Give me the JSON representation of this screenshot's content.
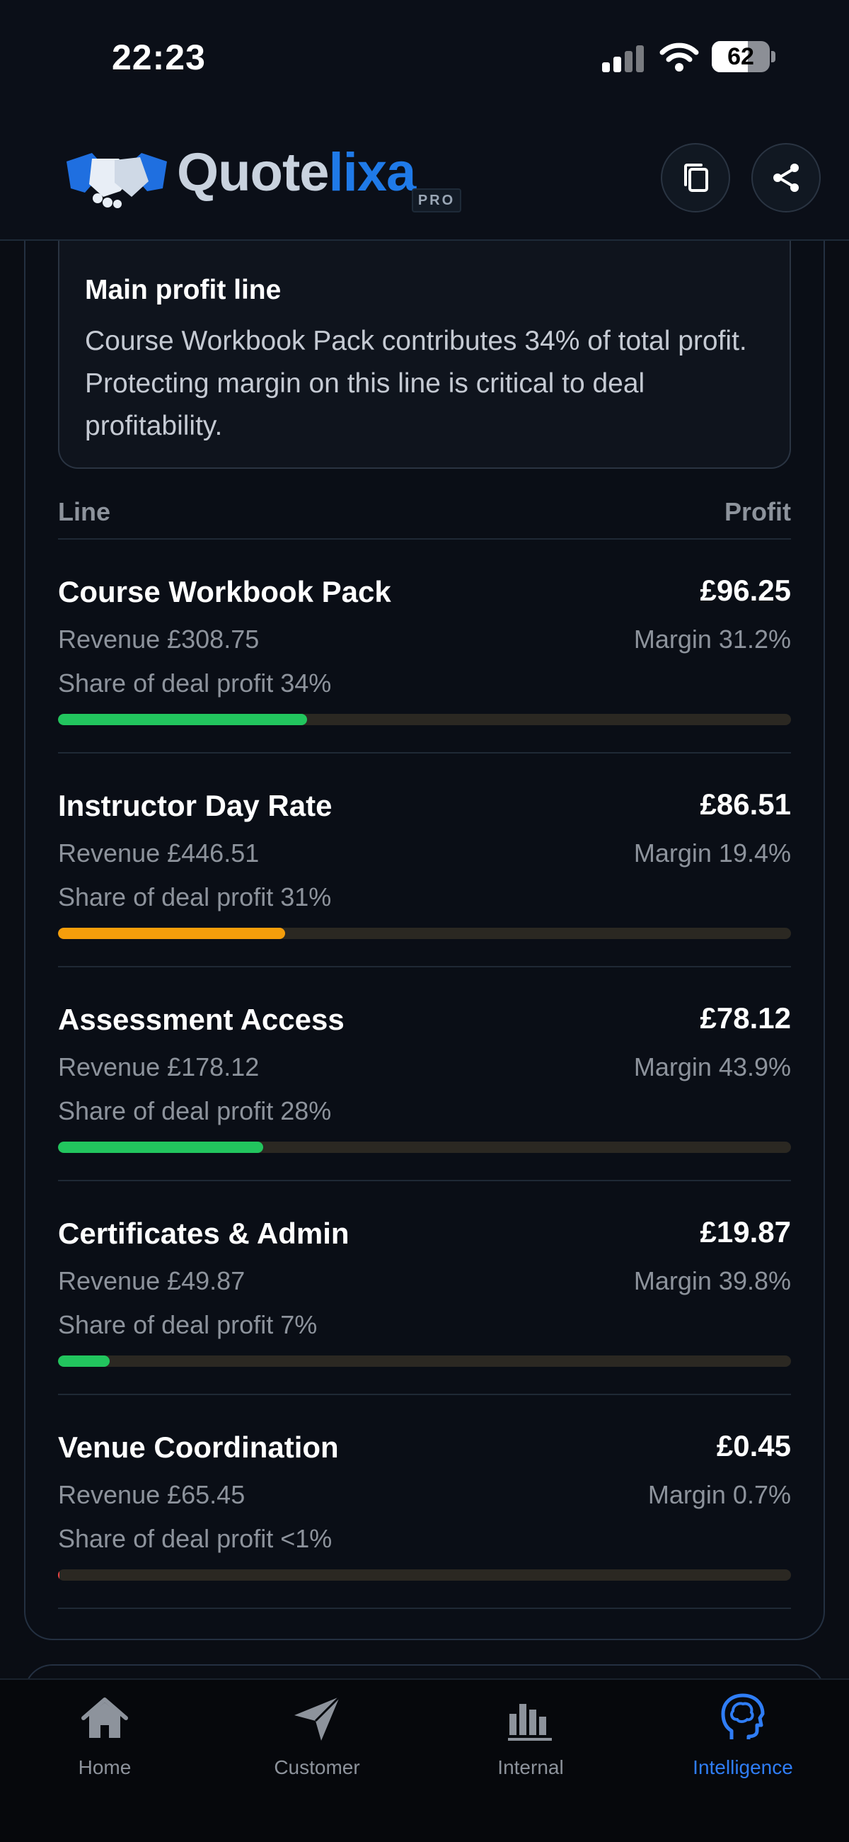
{
  "status_bar": {
    "time": "22:23",
    "battery": "62"
  },
  "header": {
    "logo_part1": "Quote",
    "logo_part2": "lixa",
    "badge": "PRO",
    "copy_icon": "copy-icon",
    "share_icon": "share-icon"
  },
  "insight": {
    "title": "Main profit line",
    "text": "Course Workbook Pack contributes 34% of total profit. Protecting margin on this line is critical to deal profitability."
  },
  "table": {
    "col_line": "Line",
    "col_profit": "Profit",
    "rows": [
      {
        "name": "Course Workbook Pack",
        "profit": "£96.25",
        "revenue": "Revenue £308.75",
        "margin": "Margin 31.2%",
        "share": "Share of deal profit 34%",
        "share_value": 34,
        "bar_color": "#22c55e"
      },
      {
        "name": "Instructor Day Rate",
        "profit": "£86.51",
        "revenue": "Revenue £446.51",
        "margin": "Margin 19.4%",
        "share": "Share of deal profit 31%",
        "share_value": 31,
        "bar_color": "#f59e0b"
      },
      {
        "name": "Assessment Access",
        "profit": "£78.12",
        "revenue": "Revenue £178.12",
        "margin": "Margin 43.9%",
        "share": "Share of deal profit 28%",
        "share_value": 28,
        "bar_color": "#22c55e"
      },
      {
        "name": "Certificates & Admin",
        "profit": "£19.87",
        "revenue": "Revenue £49.87",
        "margin": "Margin 39.8%",
        "share": "Share of deal profit 7%",
        "share_value": 7,
        "bar_color": "#22c55e"
      },
      {
        "name": "Venue Coordination",
        "profit": "£0.45",
        "revenue": "Revenue £65.45",
        "margin": "Margin 0.7%",
        "share": "Share of deal profit <1%",
        "share_value": 0.2,
        "bar_color": "#ef4444"
      }
    ]
  },
  "nav": {
    "home": "Home",
    "customer": "Customer",
    "internal": "Internal",
    "intelligence": "Intelligence",
    "active": "intelligence",
    "active_color": "#2f7df6"
  }
}
